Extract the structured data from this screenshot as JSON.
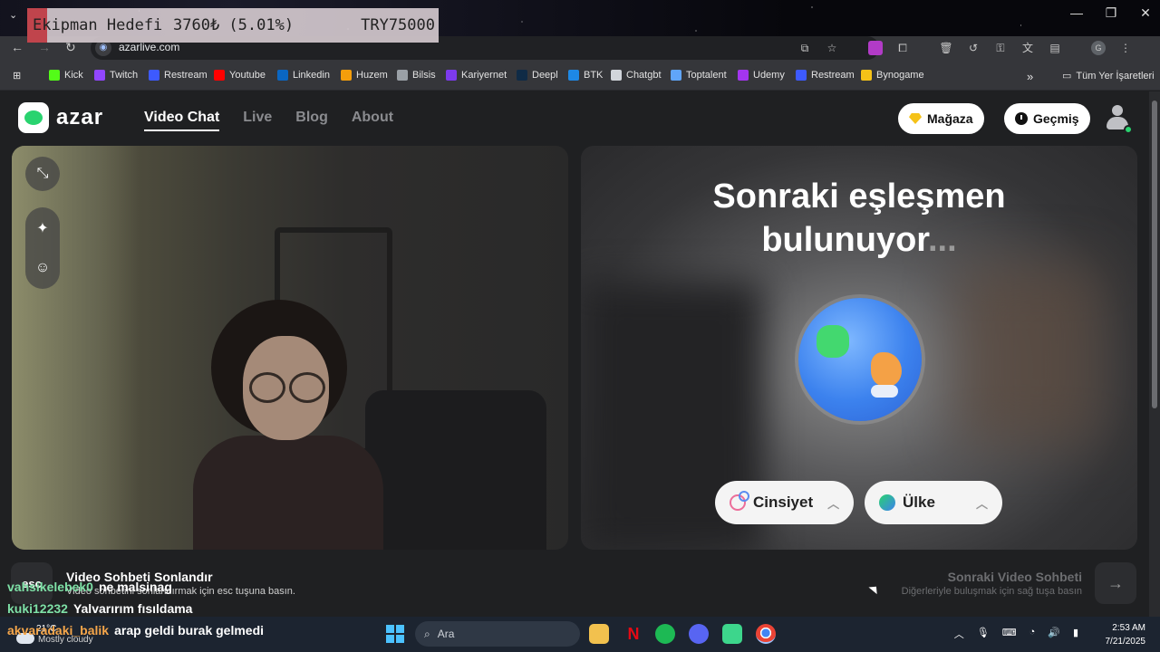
{
  "browser": {
    "url": "azarlive.com",
    "nav": {
      "back": "←",
      "forward": "→",
      "reload": "↻"
    },
    "window_controls": [
      "—",
      "❐",
      "✕"
    ],
    "bookmarks": [
      {
        "label": "Kick",
        "color": "#53fc18"
      },
      {
        "label": "Twitch",
        "color": "#9146ff"
      },
      {
        "label": "Restream",
        "color": "#3d5afe"
      },
      {
        "label": "Youtube",
        "color": "#ff0000"
      },
      {
        "label": "Linkedin",
        "color": "#0a66c2"
      },
      {
        "label": "Huzem",
        "color": "#f59e0b"
      },
      {
        "label": "Bilsis",
        "color": "#9aa0a6"
      },
      {
        "label": "Kariyernet",
        "color": "#7c3aed"
      },
      {
        "label": "Deepl",
        "color": "#0f2b46"
      },
      {
        "label": "BTK",
        "color": "#1e88e5"
      },
      {
        "label": "Chatgbt",
        "color": "#d1d5db"
      },
      {
        "label": "Toptalent",
        "color": "#60a5fa"
      },
      {
        "label": "Udemy",
        "color": "#a435f0"
      },
      {
        "label": "Restream",
        "color": "#3d5afe"
      },
      {
        "label": "Bynogame",
        "color": "#f5c218"
      }
    ],
    "all_bookmarks": "Tüm Yer İşaretleri"
  },
  "stream_overlay": {
    "label": "Ekipman Hedefi",
    "progress": "3760₺ (5.01%)",
    "goal": "TRY75000"
  },
  "azar": {
    "logo": "azar",
    "menu": [
      {
        "label": "Video Chat",
        "active": true
      },
      {
        "label": "Live",
        "active": false
      },
      {
        "label": "Blog",
        "active": false
      },
      {
        "label": "About",
        "active": false
      }
    ],
    "shop_button": "Mağaza",
    "history_button": "Geçmiş",
    "searching_title": "Sonraki eşleşmen bulunuyor",
    "searching_dots": "...",
    "gender_filter": "Cinsiyet",
    "country_filter": "Ülke",
    "end_key": "esc",
    "end_title": "Video Sohbeti Sonlandır",
    "end_subtitle": "Video sohbetini sonlandırmak için esc tuşuna basın.",
    "next_title": "Sonraki Video Sohbeti",
    "next_subtitle": "Diğerleriyle buluşmak için sağ tuşa basın"
  },
  "chat": [
    {
      "user": "vahsikelebek0",
      "message": "ne malsinag",
      "color": "#7ee0a6"
    },
    {
      "user": "kuki12232",
      "message": "Yalvarırım fısıldama",
      "color": "#7ee0a6"
    },
    {
      "user": "akvaradaki_balik",
      "message": "arap geldi burak gelmedi",
      "color": "#f5a64a"
    }
  ],
  "taskbar": {
    "weather_temp": "21°C",
    "weather_cond": "Mostly cloudy",
    "search_placeholder": "Ara",
    "time": "2:53 AM",
    "date": "7/21/2025"
  }
}
